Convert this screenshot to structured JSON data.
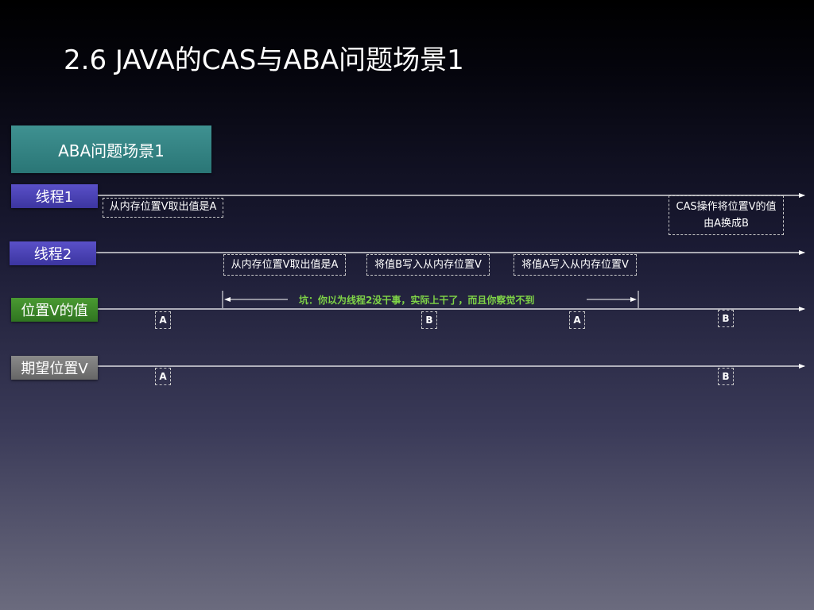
{
  "title": "2.6 JAVA的CAS与ABA问题场景1",
  "scene_label": "ABA问题场景1",
  "lanes": {
    "thread1": "线程1",
    "thread2": "线程2",
    "value": "位置V的值",
    "expected": "期望位置V"
  },
  "notes": {
    "t1_read": "从内存位置V取出值是A",
    "t1_cas": "CAS操作将位置V的值由A换成B",
    "t2_read": "从内存位置V取出值是A",
    "t2_write_b": "将值B写入从内存位置V",
    "t2_write_a": "将值A写入从内存位置V"
  },
  "pit_annotation": "坑：你以为线程2没干事，实际上干了，而且你察觉不到",
  "value_markers": [
    "A",
    "B",
    "A",
    "B"
  ],
  "expected_markers": [
    "A",
    "B"
  ],
  "colors": {
    "thread_lane": "#4a42b8",
    "value_lane": "#3f8a2a",
    "expected_lane": "#777777",
    "scene_box": "#338484",
    "pit_text": "#7fd447"
  }
}
